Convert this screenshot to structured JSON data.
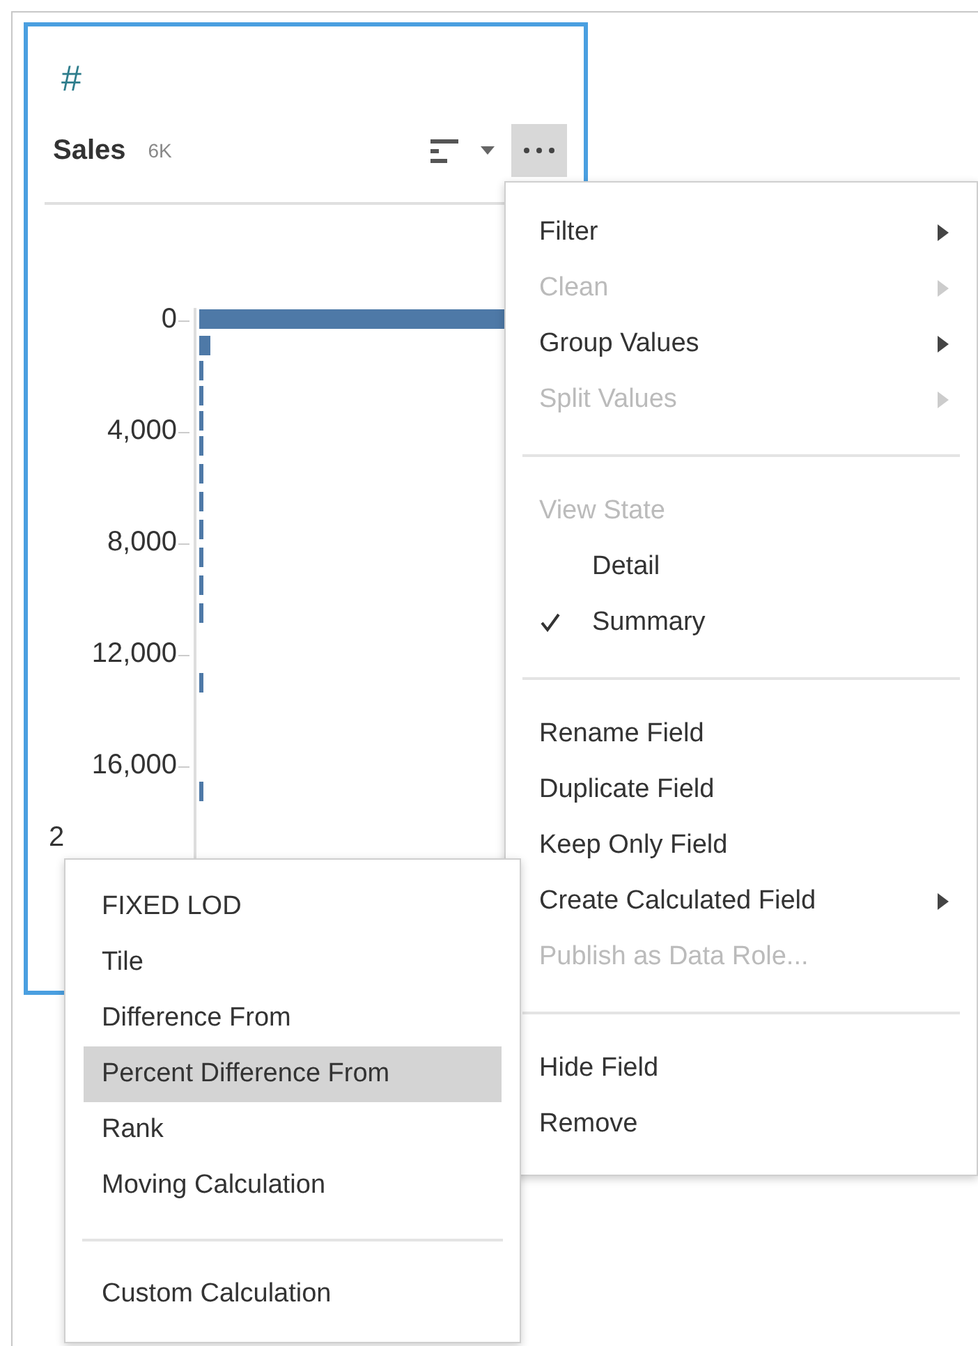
{
  "field": {
    "type_icon": "#",
    "name": "Sales",
    "count": "6K"
  },
  "axis_labels": [
    "0",
    "4,000",
    "8,000",
    "12,000",
    "16,000",
    "2"
  ],
  "menu": {
    "items": [
      {
        "kind": "item",
        "label": "Filter",
        "disabled": false,
        "submenu": true
      },
      {
        "kind": "item",
        "label": "Clean",
        "disabled": true,
        "submenu": true
      },
      {
        "kind": "item",
        "label": "Group Values",
        "disabled": false,
        "submenu": true
      },
      {
        "kind": "item",
        "label": "Split Values",
        "disabled": true,
        "submenu": true
      },
      {
        "kind": "divider"
      },
      {
        "kind": "header",
        "label": "View State"
      },
      {
        "kind": "option",
        "label": "Detail",
        "checked": false
      },
      {
        "kind": "option",
        "label": "Summary",
        "checked": true
      },
      {
        "kind": "divider"
      },
      {
        "kind": "item",
        "label": "Rename Field",
        "disabled": false,
        "submenu": false
      },
      {
        "kind": "item",
        "label": "Duplicate Field",
        "disabled": false,
        "submenu": false
      },
      {
        "kind": "item",
        "label": "Keep Only Field",
        "disabled": false,
        "submenu": false
      },
      {
        "kind": "item",
        "label": "Create Calculated Field",
        "disabled": false,
        "submenu": true
      },
      {
        "kind": "item",
        "label": "Publish as Data Role...",
        "disabled": true,
        "submenu": false
      },
      {
        "kind": "divider"
      },
      {
        "kind": "item",
        "label": "Hide Field",
        "disabled": false,
        "submenu": false
      },
      {
        "kind": "item",
        "label": "Remove",
        "disabled": false,
        "submenu": false
      }
    ]
  },
  "submenu": {
    "items": [
      {
        "kind": "item",
        "label": "FIXED LOD",
        "selected": false
      },
      {
        "kind": "item",
        "label": "Tile",
        "selected": false
      },
      {
        "kind": "item",
        "label": "Difference From",
        "selected": false
      },
      {
        "kind": "item",
        "label": "Percent Difference From",
        "selected": true
      },
      {
        "kind": "item",
        "label": "Rank",
        "selected": false
      },
      {
        "kind": "item",
        "label": "Moving Calculation",
        "selected": false
      },
      {
        "kind": "divider"
      },
      {
        "kind": "item",
        "label": "Custom Calculation",
        "selected": false
      }
    ]
  }
}
